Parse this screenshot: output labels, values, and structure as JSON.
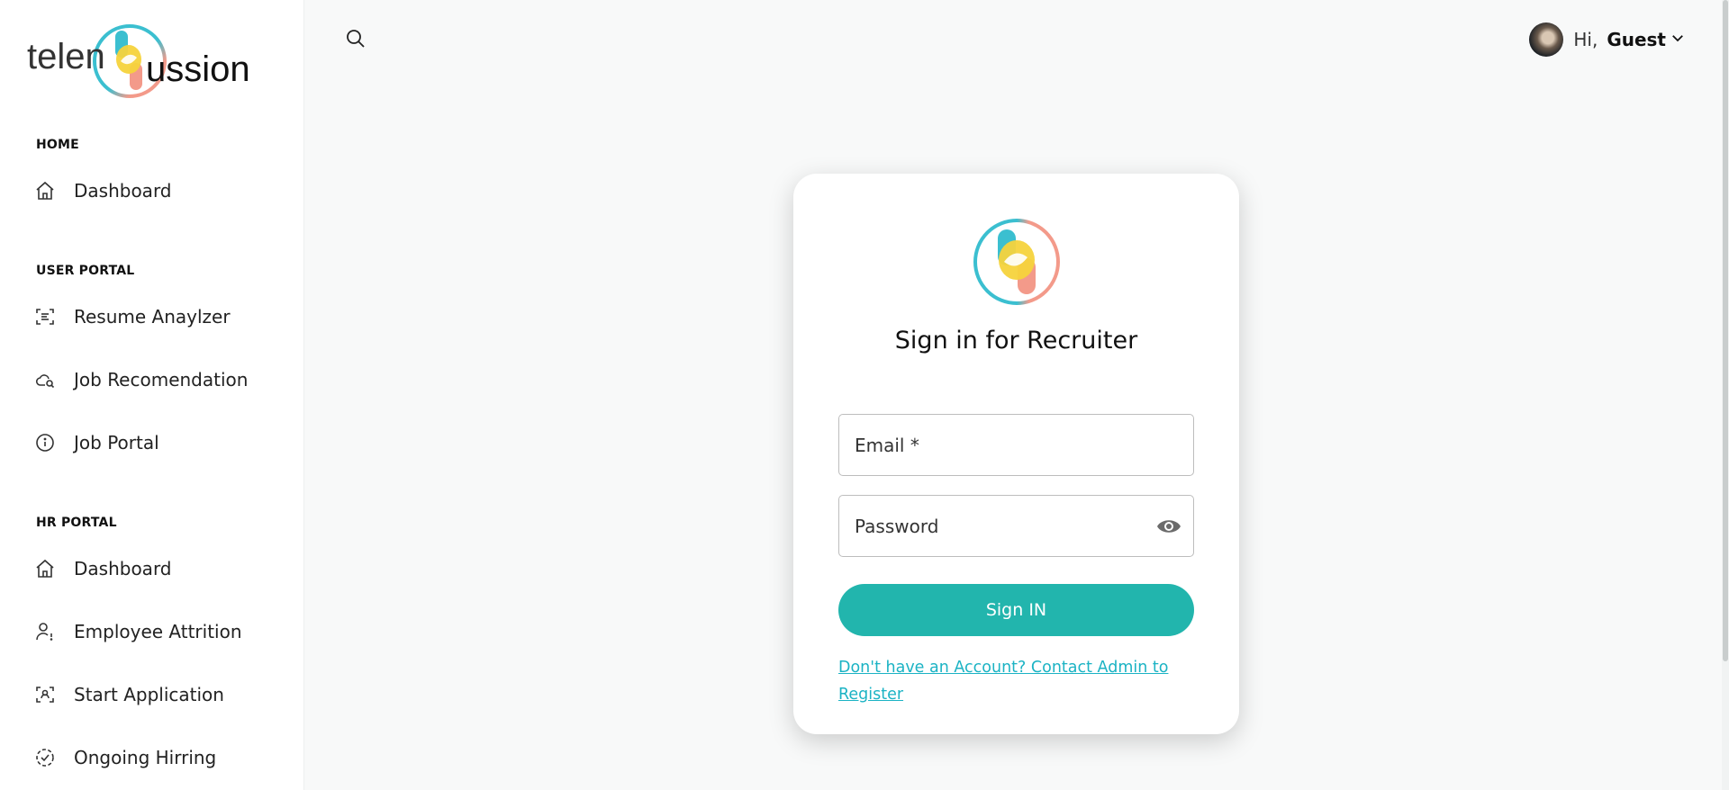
{
  "brand": {
    "logo_text_left": "telen",
    "logo_text_right": "ussion",
    "colors": {
      "teal": "#22b5ad",
      "cyan": "#3bbfd0",
      "yellow": "#f5d33c",
      "coral": "#f39a8a"
    }
  },
  "sidebar": {
    "sections": [
      {
        "label": "HOME",
        "items": [
          {
            "label": "Dashboard",
            "icon": "home-icon"
          }
        ]
      },
      {
        "label": "USER PORTAL",
        "items": [
          {
            "label": "Resume Anaylzer",
            "icon": "scan-document-icon"
          },
          {
            "label": "Job Recomendation",
            "icon": "cloud-search-icon"
          },
          {
            "label": "Job Portal",
            "icon": "info-circle-icon"
          }
        ]
      },
      {
        "label": "HR PORTAL",
        "items": [
          {
            "label": "Dashboard",
            "icon": "home-icon"
          },
          {
            "label": "Employee Attrition",
            "icon": "user-alert-icon"
          },
          {
            "label": "Start Application",
            "icon": "scan-user-icon"
          },
          {
            "label": "Ongoing Hirring",
            "icon": "check-circle-dashed-icon"
          }
        ]
      }
    ]
  },
  "topbar": {
    "search_icon": "search-icon",
    "greeting": "Hi,",
    "username": "Guest",
    "dropdown_icon": "chevron-down-icon"
  },
  "login": {
    "title": "Sign in for Recruiter",
    "email_label": "Email *",
    "password_label": "Password",
    "password_toggle_icon": "eye-icon",
    "submit_label": "Sign IN",
    "register_link": "Don't have an Account? Contact Admin to Register"
  }
}
